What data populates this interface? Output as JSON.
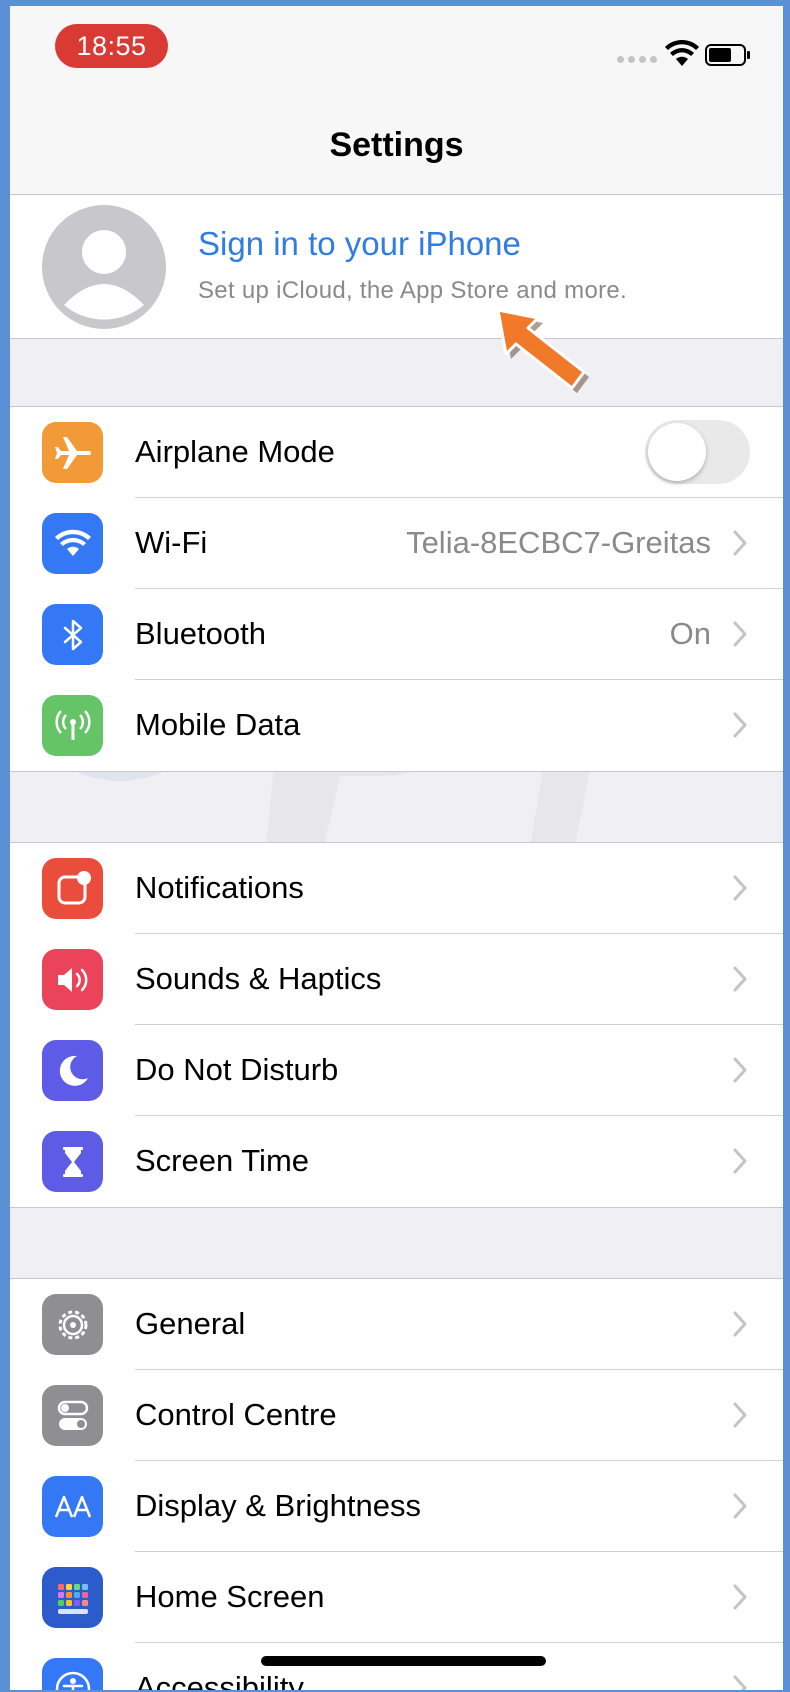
{
  "status_bar": {
    "time": "18:55"
  },
  "nav": {
    "title": "Settings"
  },
  "profile": {
    "title": "Sign in to your iPhone",
    "subtitle": "Set up iCloud, the App Store and more."
  },
  "groups": [
    {
      "items": [
        {
          "label": "Airplane Mode",
          "icon": "airplane-icon",
          "color": "#f19a37",
          "control": "toggle",
          "toggle_on": false
        },
        {
          "label": "Wi-Fi",
          "icon": "wifi-icon",
          "color": "#3478f6",
          "value": "Telia-8ECBC7-Greitas"
        },
        {
          "label": "Bluetooth",
          "icon": "bluetooth-icon",
          "color": "#3478f6",
          "value": "On"
        },
        {
          "label": "Mobile Data",
          "icon": "antenna-icon",
          "color": "#65c466"
        }
      ]
    },
    {
      "items": [
        {
          "label": "Notifications",
          "icon": "notifications-icon",
          "color": "#eb4d3d"
        },
        {
          "label": "Sounds & Haptics",
          "icon": "speaker-icon",
          "color": "#eb445a"
        },
        {
          "label": "Do Not Disturb",
          "icon": "moon-icon",
          "color": "#5e5ce6"
        },
        {
          "label": "Screen Time",
          "icon": "hourglass-icon",
          "color": "#5e5ce6"
        }
      ]
    },
    {
      "items": [
        {
          "label": "General",
          "icon": "gear-icon",
          "color": "#8e8e93"
        },
        {
          "label": "Control Centre",
          "icon": "switches-icon",
          "color": "#8e8e93"
        },
        {
          "label": "Display & Brightness",
          "icon": "text-size-icon",
          "color": "#3478f6"
        },
        {
          "label": "Home Screen",
          "icon": "grid-icon",
          "color": "#2c5ccc"
        },
        {
          "label": "Accessibility",
          "icon": "accessibility-icon",
          "color": "#3478f6"
        }
      ]
    }
  ]
}
